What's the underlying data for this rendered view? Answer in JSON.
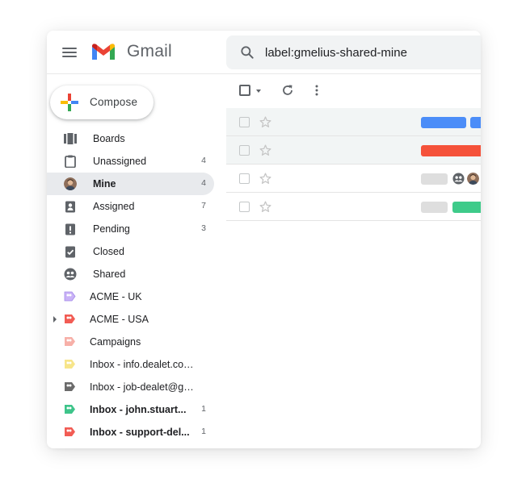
{
  "app": {
    "logo_text": "Gmail"
  },
  "search": {
    "value": "label:gmelius-shared-mine"
  },
  "compose": {
    "label": "Compose"
  },
  "sidebar": {
    "items": [
      {
        "label": "Boards",
        "count": "",
        "icon": "boards-icon"
      },
      {
        "label": "Unassigned",
        "count": "4",
        "icon": "clipboard-icon"
      },
      {
        "label": "Mine",
        "count": "4",
        "icon": "avatar"
      },
      {
        "label": "Assigned",
        "count": "7",
        "icon": "assigned-clipboard-icon"
      },
      {
        "label": "Pending",
        "count": "3",
        "icon": "pending-clipboard-icon"
      },
      {
        "label": "Closed",
        "count": "",
        "icon": "closed-clipboard-icon"
      },
      {
        "label": "Shared",
        "count": "",
        "icon": "shared-icon"
      },
      {
        "label": "ACME - UK",
        "count": "",
        "icon": "label-icon",
        "color": "#b794f4"
      },
      {
        "label": "ACME - USA",
        "count": "",
        "icon": "label-icon",
        "color": "#f25c54"
      },
      {
        "label": "Campaigns",
        "count": "",
        "icon": "label-icon",
        "color": "#f7a8a0"
      },
      {
        "label": "Inbox - info.dealet.com...",
        "count": "",
        "icon": "label-icon",
        "color": "#f6e27a"
      },
      {
        "label": "Inbox - job-dealet@goo...",
        "count": "",
        "icon": "label-icon",
        "color": "#6b6b6b"
      },
      {
        "label": "Inbox - john.stuart...",
        "count": "1",
        "icon": "label-icon",
        "color": "#3ec48a"
      },
      {
        "label": "Inbox - support-del...",
        "count": "1",
        "icon": "label-icon",
        "color": "#f25c54"
      }
    ]
  },
  "colors": {
    "active_bg": "#e8eaed",
    "blue_chip": "#4b8df8",
    "red_chip": "#f5523a",
    "green_chip": "#3ecb8a",
    "grey_chip": "#dedede"
  }
}
